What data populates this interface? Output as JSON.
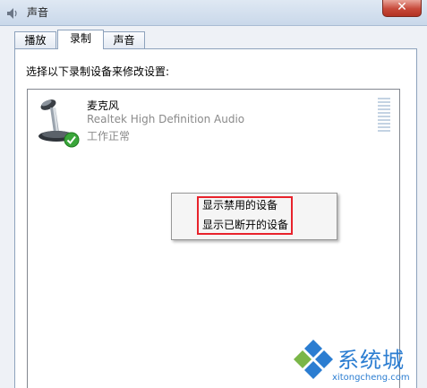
{
  "window": {
    "title": "声音",
    "close_label": "✕",
    "title_icon": "speaker-icon"
  },
  "tabs": [
    {
      "label": "播放",
      "active": false
    },
    {
      "label": "录制",
      "active": true
    },
    {
      "label": "声音",
      "active": false
    }
  ],
  "panel": {
    "instruction": "选择以下录制设备来修改设置:"
  },
  "devices": [
    {
      "name": "麦克风",
      "description": "Realtek High Definition Audio",
      "status": "工作正常",
      "icon": "microphone-icon",
      "status_icon": "checkmark-icon"
    }
  ],
  "context_menu": {
    "items": [
      {
        "label": "显示禁用的设备"
      },
      {
        "label": "显示已断开的设备"
      }
    ]
  },
  "watermark": {
    "text": "系统城",
    "url": "xitongcheng.com"
  },
  "colors": {
    "highlight_border": "#e8232c",
    "watermark_blue": "#2b7dd1",
    "watermark_green": "#7ab648",
    "checkmark_green": "#3aa63a"
  }
}
